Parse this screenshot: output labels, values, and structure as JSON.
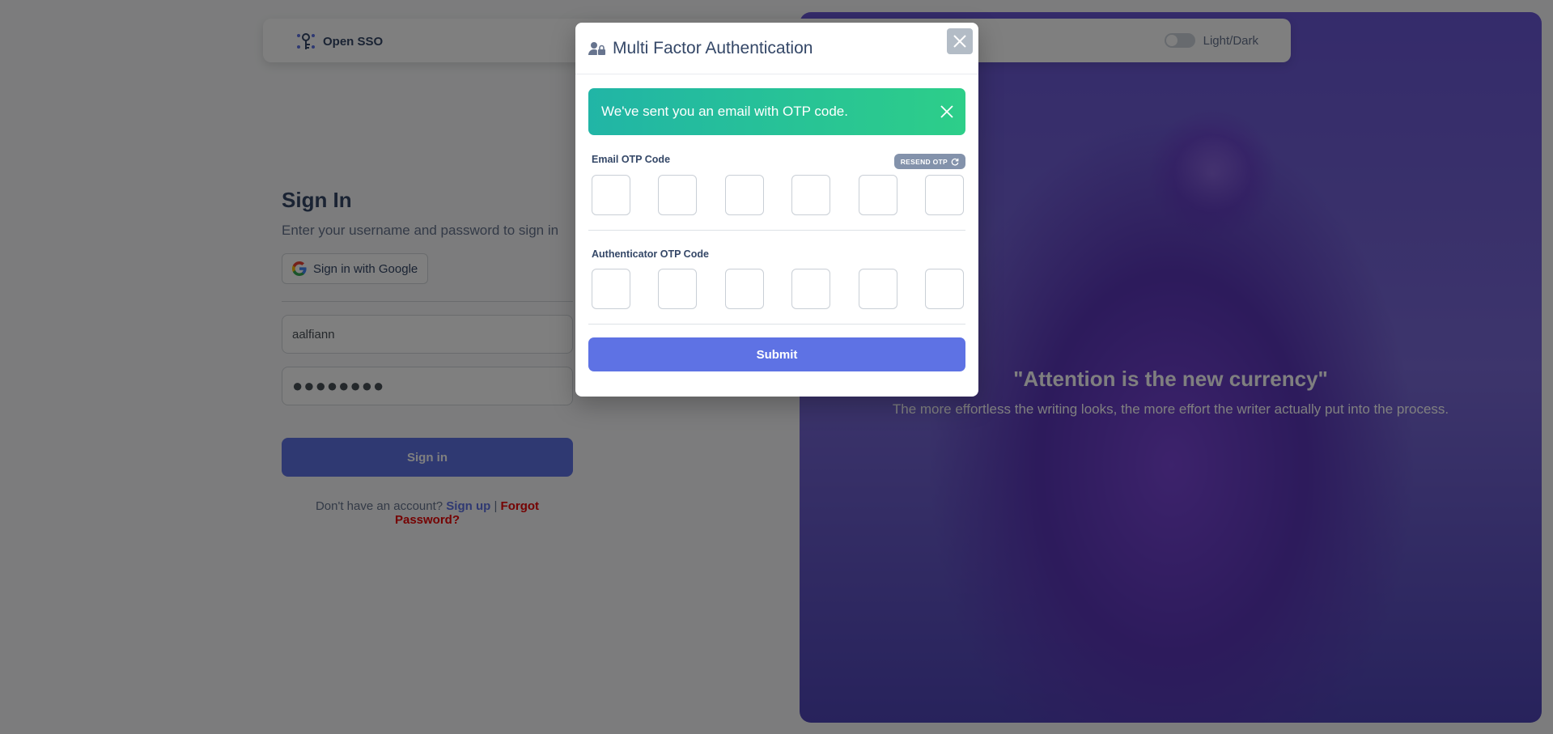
{
  "navbar": {
    "brand": "Open SSO",
    "theme_label": "Light/Dark"
  },
  "signin": {
    "title": "Sign In",
    "subtitle": "Enter your username and password to sign in",
    "google_label": "Sign in with Google",
    "username_value": "aalfiann",
    "password_value": "●●●●●●●●",
    "submit_label": "Sign in",
    "no_account_text": "Don't have an account?",
    "signup_label": "Sign up",
    "separator": "|",
    "forgot_label": "Forgot Password?"
  },
  "hero": {
    "quote": "\"Attention is the new currency\"",
    "subtext": "The more effortless the writing looks, the more effort the writer actually put into the process."
  },
  "modal": {
    "title": "Multi Factor Authentication",
    "alert_text": "We've sent you an email with OTP code.",
    "email_otp_label": "Email OTP Code",
    "resend_label": "RESEND OTP",
    "auth_otp_label": "Authenticator OTP Code",
    "submit_label": "Submit",
    "email_otp_digits": [
      "",
      "",
      "",
      "",
      "",
      ""
    ],
    "auth_otp_digits": [
      "",
      "",
      "",
      "",
      "",
      ""
    ]
  },
  "colors": {
    "primary": "#5e72e4",
    "success_gradient_start": "#21b5a6",
    "success_gradient_end": "#2dce89",
    "danger": "#ea0606",
    "secondary": "#8392ab"
  }
}
